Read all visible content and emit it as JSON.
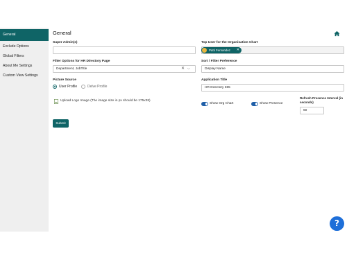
{
  "sidebar": {
    "items": [
      {
        "label": "General"
      },
      {
        "label": "Exclude Options"
      },
      {
        "label": "Global Filters"
      },
      {
        "label": "About Me Settings"
      },
      {
        "label": "Custom View Settings"
      }
    ]
  },
  "page": {
    "title": "General"
  },
  "form": {
    "super_admins": {
      "label": "Super Admin(s)",
      "value": ""
    },
    "top_user": {
      "label": "Top User for the Organisation Chart",
      "chip": "Patti Fernandez"
    },
    "filter_options": {
      "label": "Filter Options for HR Directory Page",
      "value": "Department, JobTitle"
    },
    "sort_filter": {
      "label": "Sort / Filter Preference",
      "value": "Display Name"
    },
    "picture_source": {
      "label": "Picture Source",
      "options": [
        {
          "label": "User Profile",
          "selected": true
        },
        {
          "label": "Delve Profile",
          "selected": false
        }
      ]
    },
    "application_title": {
      "label": "Application Title",
      "value": "HR Directory 365"
    },
    "upload_logo": {
      "text": "Upload Logo Image (The image size in px should be 175x38)"
    },
    "toggles": [
      {
        "label": "Show Org Chart",
        "on": true
      },
      {
        "label": "Show Presence",
        "on": true
      }
    ],
    "refresh_interval": {
      "label": "Refresh Presence Interval (in seconds)",
      "value": "60"
    },
    "submit_label": "Submit"
  },
  "help": {
    "label": "?"
  },
  "colors": {
    "accent": "#0f6466",
    "toggle": "#1f5fa8",
    "help": "#1e6fd9"
  }
}
